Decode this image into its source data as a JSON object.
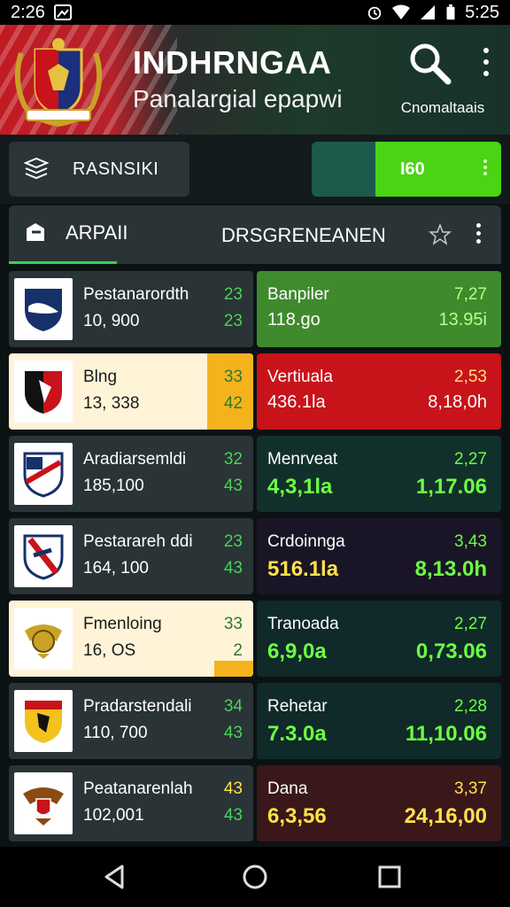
{
  "status": {
    "time_left": "2:26",
    "time_right": "5:25"
  },
  "header": {
    "title": "INDHRNGAA",
    "subtitle": "Panalargial epapwi",
    "action_label": "Cnomaltaais",
    "accent": "#c21a22"
  },
  "filter": {
    "label": "RASNSIKI"
  },
  "score_pill": {
    "value": "I60",
    "color": "#4ad414"
  },
  "tabs": [
    {
      "label": "ARPAII"
    },
    {
      "label": "DRSGRENEANEN"
    }
  ],
  "rows": [
    {
      "name": "Pestanarordth",
      "pop": "10, 900",
      "n1": "23",
      "n2": "23",
      "style": "dark",
      "right": {
        "name": "Banpiler",
        "value": "118.go",
        "pct": "7,27",
        "big": "13.95i",
        "bg": "#3f8a2c",
        "text": "#ffffff",
        "num": "#b6ff8a"
      }
    },
    {
      "name": "Blng",
      "pop": "13, 338",
      "n1": "33",
      "n2": "42",
      "style": "light-band",
      "right": {
        "name": "Vertiuala",
        "value": "436.1la",
        "pct": "2,53",
        "big": "8,18,0h",
        "bg": "#c8131a",
        "text": "#ffffff",
        "num": "#ffe082"
      }
    },
    {
      "name": "Aradiarsemldi",
      "pop": "185,100",
      "n1": "32",
      "n2": "43",
      "style": "dark",
      "right": {
        "name": "Menrveat",
        "value": "4,3,1la",
        "pct": "2,27",
        "big": "1,17.06",
        "bg": "#12302b",
        "text": "#ffffff",
        "num": "#6cff44"
      }
    },
    {
      "name": "Pestarareh ddi",
      "pop": "164, 100",
      "n1": "23",
      "n2": "43",
      "style": "dark",
      "right": {
        "name": "Crdoinnga",
        "value": "516.1la",
        "pct": "3,43",
        "big": "8,13.0h",
        "bg": "#1a1526",
        "text": "#ffffff",
        "num": "#ffe14a"
      }
    },
    {
      "name": "Fmenloing",
      "pop": "16, OS",
      "n1": "33",
      "n2": "2",
      "style": "light-small",
      "right": {
        "name": "Tranoada",
        "value": "6,9,0a",
        "pct": "2,27",
        "big": "0,73.06",
        "bg": "#0f2a28",
        "text": "#ffffff",
        "num": "#6cff44"
      }
    },
    {
      "name": "Pradarstendali",
      "pop": "110, 700",
      "n1": "34",
      "n2": "43",
      "style": "dark",
      "right": {
        "name": "Rehetar",
        "value": "7.3.0a",
        "pct": "2,28",
        "big": "11,10.06",
        "bg": "#0f2a28",
        "text": "#ffffff",
        "num": "#6cff44"
      }
    },
    {
      "name": "Peatanarenlah",
      "pop": "102,001",
      "n1": "43",
      "n2": "43",
      "style": "dark",
      "right": {
        "name": "Dana",
        "value": "6,3,56",
        "pct": "3,37",
        "big": "24,16,00",
        "bg": "#3a1719",
        "text": "#ffffff",
        "num": "#ffe14a"
      }
    }
  ]
}
